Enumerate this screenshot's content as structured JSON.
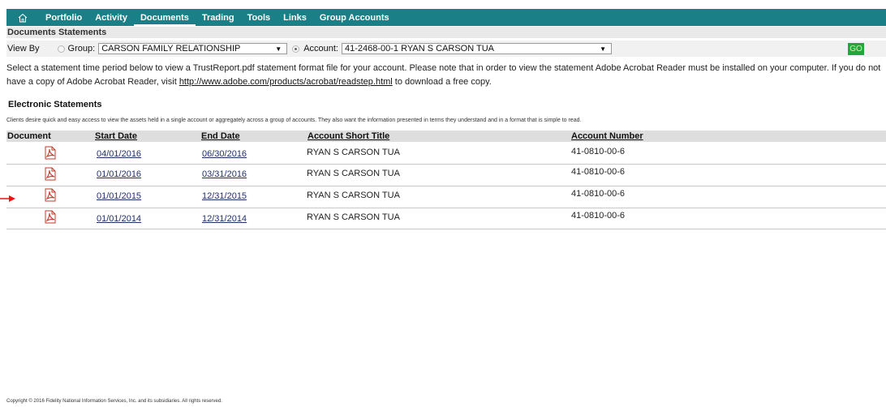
{
  "nav": {
    "items": [
      "Portfolio",
      "Activity",
      "Documents",
      "Trading",
      "Tools",
      "Links",
      "Group Accounts"
    ],
    "active": "Documents",
    "accent_color": "#1a7f86"
  },
  "page_title": "Documents Statements",
  "view_by": {
    "label": "View By",
    "group_label": "Group:",
    "group_value": "CARSON FAMILY RELATIONSHIP",
    "account_label": "Account:",
    "account_value": "41-2468-00-1 RYAN S CARSON TUA",
    "go_label": "GO"
  },
  "intro": {
    "text1": "Select a statement time period below to view a TrustReport.pdf statement format file for your account. Please note that in order to view the statement Adobe Acrobat Reader must be installed on your computer. If you do not have a copy of Adobe Acrobat Reader, visit ",
    "link": "http://www.adobe.com/products/acrobat/readstep.html",
    "text2": " to download a free copy."
  },
  "electronic_statements": {
    "title": "Electronic Statements",
    "description": "Clients desire quick and easy access to view the assets held in a single account or aggregately across a group of accounts. They also want the information presented in terms they understand and in a format that is simple to read."
  },
  "table": {
    "headers": {
      "document": "Document",
      "start_date": "Start Date",
      "end_date": "End Date",
      "title": "Account Short Title",
      "number": "Account Number"
    },
    "rows": [
      {
        "start": "04/01/2016",
        "end": "06/30/2016",
        "title": "RYAN S CARSON TUA",
        "number": "41-0810-00-6"
      },
      {
        "start": "01/01/2016",
        "end": "03/31/2016",
        "title": "RYAN S CARSON TUA",
        "number": "41-0810-00-6"
      },
      {
        "start": "01/01/2015",
        "end": "12/31/2015",
        "title": "RYAN S CARSON TUA",
        "number": "41-0810-00-6"
      },
      {
        "start": "01/01/2014",
        "end": "12/31/2014",
        "title": "RYAN S CARSON TUA",
        "number": "41-0810-00-6"
      }
    ]
  },
  "footer": "Copyright © 2016 Fidelity National Information Services, Inc. and its subsidiaries. All rights reserved."
}
